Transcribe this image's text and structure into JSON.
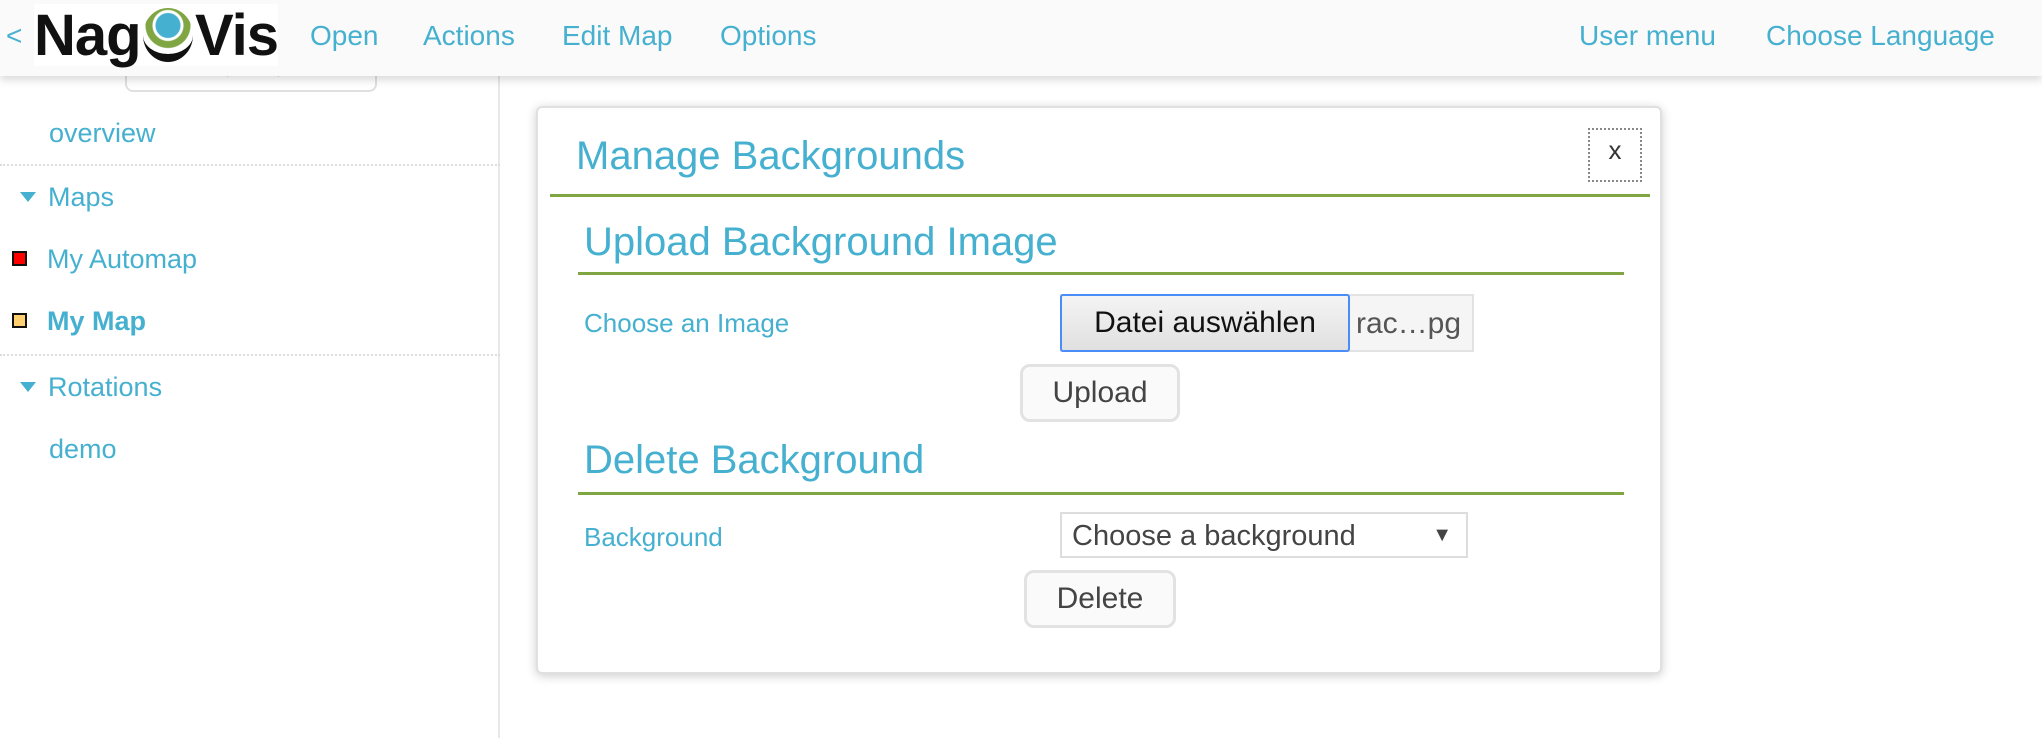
{
  "header": {
    "back": "<",
    "logo": {
      "left": "Nag",
      "right": "Vis"
    },
    "menu": [
      "Open",
      "Actions",
      "Edit Map",
      "Options"
    ],
    "right_menu": [
      "User menu",
      "Choose Language"
    ]
  },
  "sidebar": {
    "items": [
      {
        "label": "overview"
      },
      {
        "label": "Maps",
        "type": "section"
      },
      {
        "label": "My Automap",
        "state_color": "#ff0000"
      },
      {
        "label": "My Map",
        "state_color": "#ffd070",
        "active": true
      },
      {
        "label": "Rotations",
        "type": "section"
      },
      {
        "label": "demo"
      }
    ]
  },
  "dialog": {
    "title": "Manage Backgrounds",
    "close": "x",
    "upload": {
      "heading": "Upload Background Image",
      "label": "Choose an Image",
      "file_button": "Datei auswählen",
      "file_name": "rac…pg",
      "submit": "Upload"
    },
    "delete": {
      "heading": "Delete Background",
      "label": "Background",
      "select_value": "Choose a background",
      "submit": "Delete"
    }
  },
  "colors": {
    "accent": "#45b0cf",
    "rule": "#7fa642"
  }
}
